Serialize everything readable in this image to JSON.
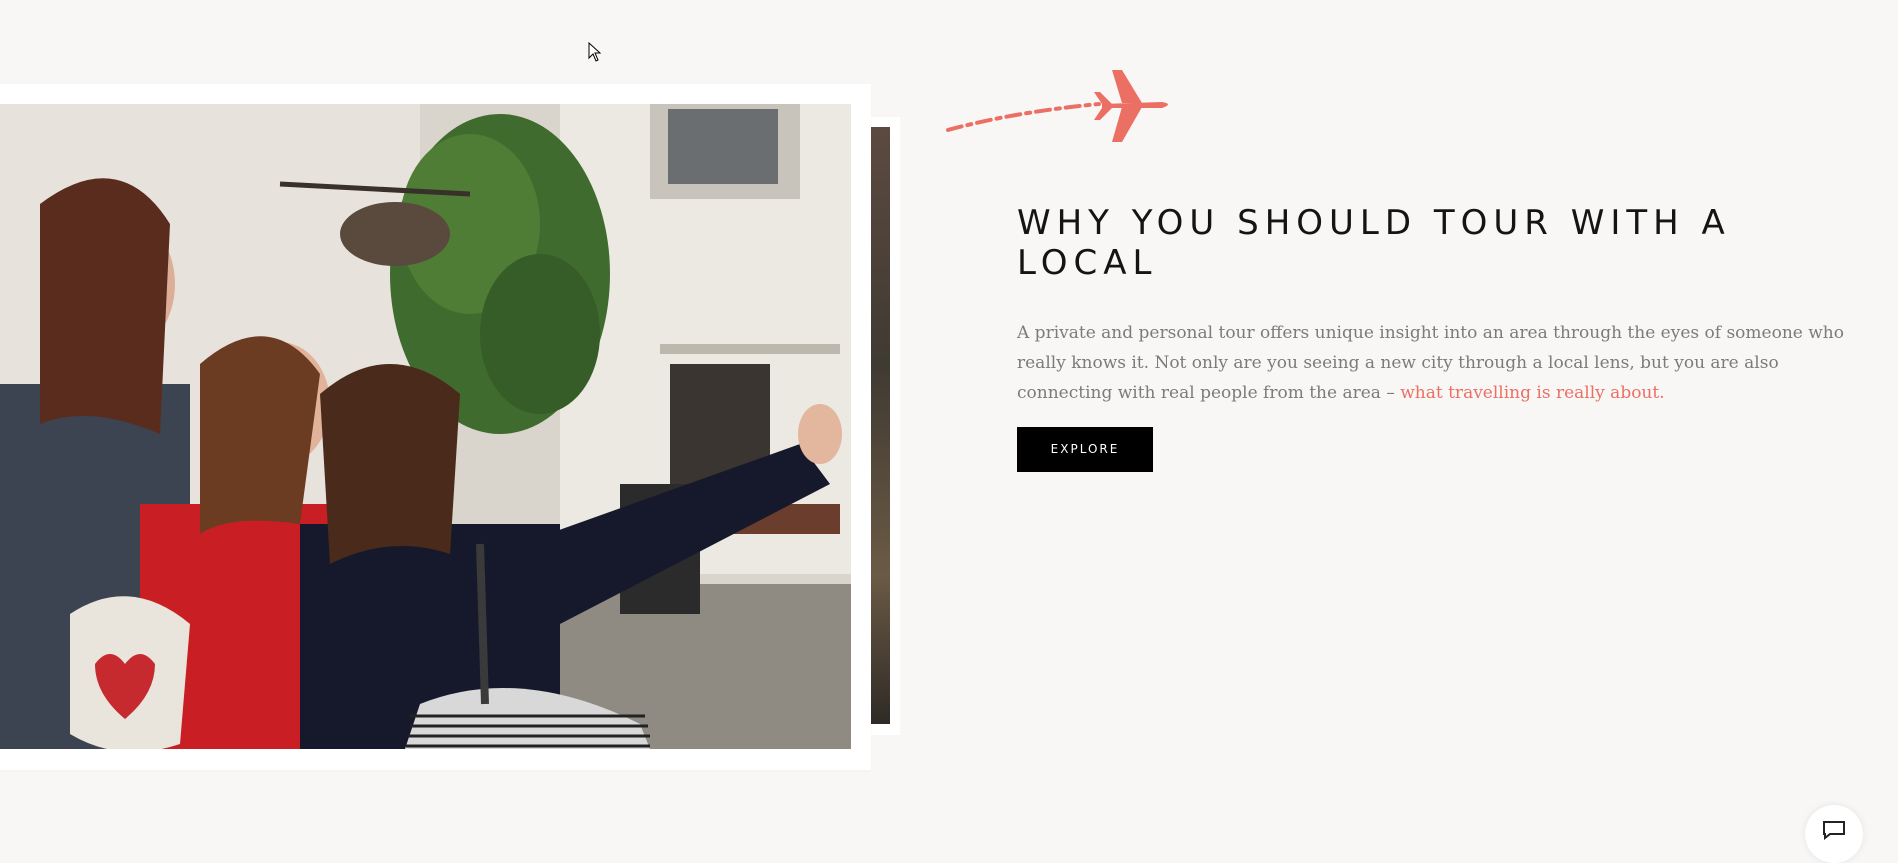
{
  "section": {
    "heading": "WHY YOU SHOULD TOUR WITH A LOCAL",
    "body_text": "A private and personal tour offers unique insight into an area through the eyes of someone who really knows it. Not only are you seeing a new city through a local lens, but you are also connecting with real people from the area – ",
    "body_link": "what travelling is really about.",
    "explore_label": "EXPLORE"
  },
  "icons": {
    "plane": "airplane-icon",
    "cursor": "mouse-pointer-icon",
    "chat": "chat-icon"
  },
  "colors": {
    "background": "#f8f7f6",
    "accent": "#ec6f63",
    "heading": "#141414",
    "body": "#7e7a77",
    "button": "#000000"
  }
}
